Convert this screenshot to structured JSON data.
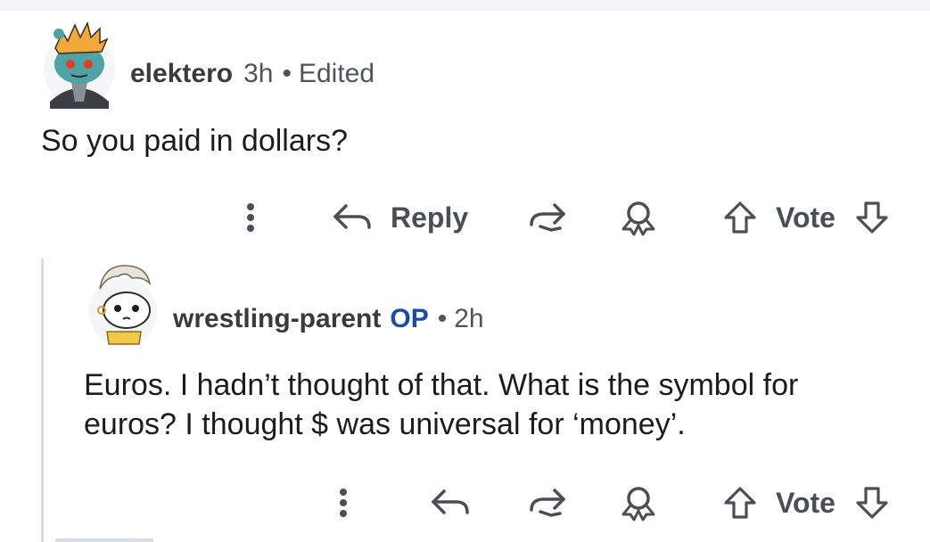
{
  "colors": {
    "op_badge": "#1a4ea0",
    "text": "#1c1c1c",
    "meta": "#4f5459",
    "icon": "#4a4f55",
    "thread_line": "#dadce0"
  },
  "comment1": {
    "username": "elektero",
    "time": "3h",
    "separator": "•",
    "edited": "Edited",
    "body": "So you paid in dollars?",
    "actions": {
      "more_icon": "more-vertical-icon",
      "reply_icon": "reply-arrow-icon",
      "reply_label": "Reply",
      "share_icon": "share-icon",
      "award_icon": "award-icon",
      "upvote_icon": "upvote-arrow-icon",
      "vote_label": "Vote",
      "downvote_icon": "downvote-arrow-icon"
    }
  },
  "comment2": {
    "username": "wrestling-parent",
    "op": "OP",
    "separator": "•",
    "time": "2h",
    "body_line1": "Euros. I hadn’t thought of that. What is the symbol for",
    "body_line2": "euros? I thought $ was universal for ‘money’.",
    "actions": {
      "more_icon": "more-vertical-icon",
      "reply_icon": "reply-arrow-icon",
      "share_icon": "share-icon",
      "award_icon": "award-icon",
      "upvote_icon": "upvote-arrow-icon",
      "vote_label": "Vote",
      "downvote_icon": "downvote-arrow-icon"
    }
  }
}
